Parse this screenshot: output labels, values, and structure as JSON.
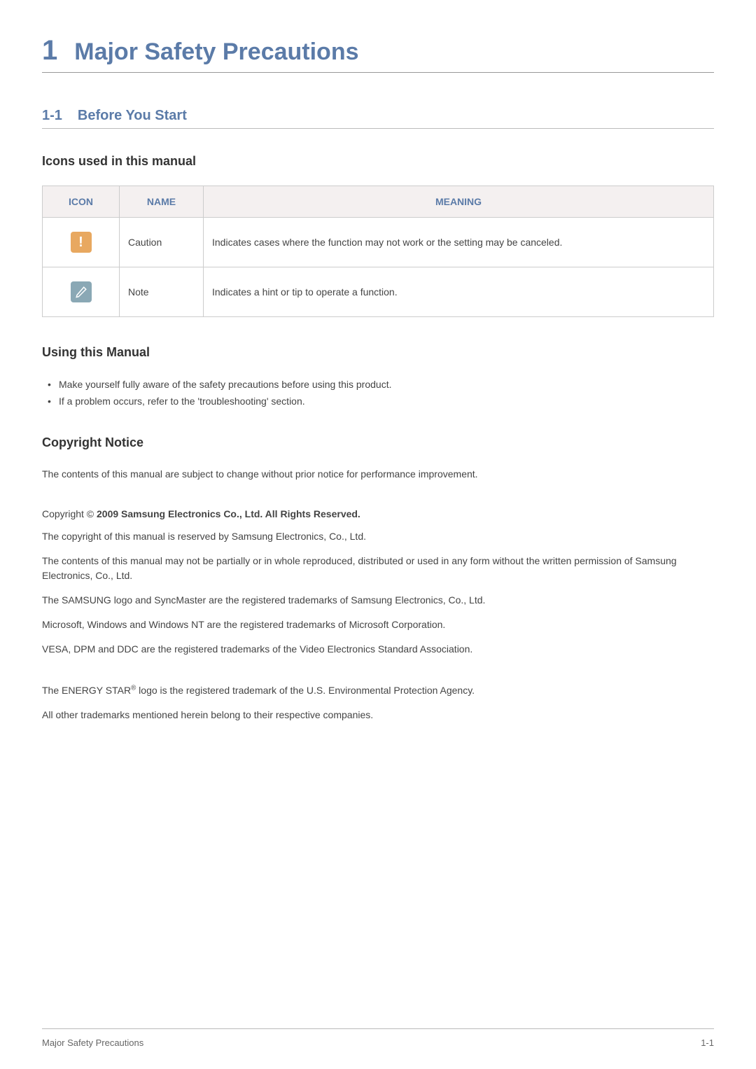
{
  "chapter": {
    "number": "1",
    "title": "Major Safety Precautions"
  },
  "section": {
    "number": "1-1",
    "title": "Before You Start"
  },
  "subsections": {
    "icons_title": "Icons used in this manual",
    "using_title": "Using this Manual",
    "copyright_title": "Copyright Notice"
  },
  "icons_table": {
    "headers": {
      "icon": "ICON",
      "name": "NAME",
      "meaning": "MEANING"
    },
    "rows": [
      {
        "name": "Caution",
        "meaning": "Indicates cases where the function may not work or the setting may be canceled."
      },
      {
        "name": "Note",
        "meaning": "Indicates a hint or tip to operate a function."
      }
    ]
  },
  "using_manual_bullets": [
    "Make yourself fully aware of the safety precautions before using this product.",
    "If a problem occurs, refer to the 'troubleshooting' section."
  ],
  "copyright": {
    "intro": "The contents of this manual are subject to change without prior notice for performance improvement.",
    "copyright_prefix": "Copyright © ",
    "copyright_bold": " 2009 Samsung Electronics Co., Ltd. All Rights Reserved.",
    "p1": "The copyright of this manual is reserved by Samsung Electronics, Co., Ltd.",
    "p2": "The contents of this manual may not be partially or in whole reproduced, distributed or used in any form without the written permission of Samsung Electronics, Co., Ltd.",
    "p3": "The SAMSUNG logo and SyncMaster are the registered trademarks of Samsung Electronics, Co., Ltd.",
    "p4": "Microsoft, Windows and Windows NT are the registered trademarks of Microsoft Corporation.",
    "p5": "VESA, DPM and DDC are the registered trademarks of the Video Electronics Standard Association.",
    "energystar_pre": "The ENERGY STAR",
    "energystar_sup": "®",
    "energystar_post": " logo is the registered trademark of the U.S. Environmental Protection Agency.",
    "p7": "All other trademarks mentioned herein belong to their respective companies."
  },
  "footer": {
    "left": "Major Safety Precautions",
    "right": "1-1"
  }
}
